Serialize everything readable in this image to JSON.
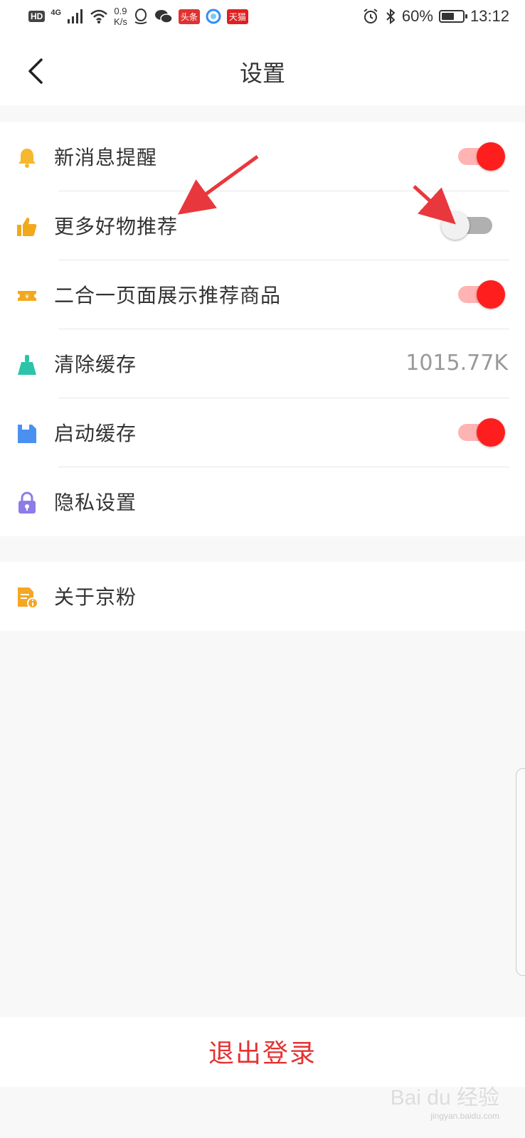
{
  "status_bar": {
    "hd": "HD",
    "network": "4G",
    "speed_value": "0.9",
    "speed_unit": "K/s",
    "app_badge_1": "头条",
    "app_badge_2": "天猫",
    "battery_percent": "60%",
    "battery_level": 0.6,
    "time": "13:12"
  },
  "nav": {
    "title": "设置"
  },
  "settings": {
    "items": [
      {
        "label": "新消息提醒",
        "toggle": "on"
      },
      {
        "label": "更多好物推荐",
        "toggle": "off"
      },
      {
        "label": "二合一页面展示推荐商品",
        "toggle": "on"
      },
      {
        "label": "清除缓存",
        "value": "1015.77K"
      },
      {
        "label": "启动缓存",
        "toggle": "on"
      },
      {
        "label": "隐私设置"
      }
    ],
    "about": {
      "label": "关于京粉"
    }
  },
  "logout": {
    "label": "退出登录"
  },
  "watermark": {
    "brand": "Bai du 经验",
    "url": "jingyan.baidu.com"
  },
  "colors": {
    "accent": "#ff1e1e",
    "logout_text": "#e53232",
    "bell_icon": "#f5b82e",
    "thumb_icon": "#f2a81d",
    "ticket_icon": "#f2a81d",
    "broom_icon": "#2cc4a8",
    "save_icon": "#4a90f0",
    "lock_icon": "#8c7ce8",
    "doc_icon": "#f5a623",
    "annotation_arrow": "#e8383d"
  }
}
